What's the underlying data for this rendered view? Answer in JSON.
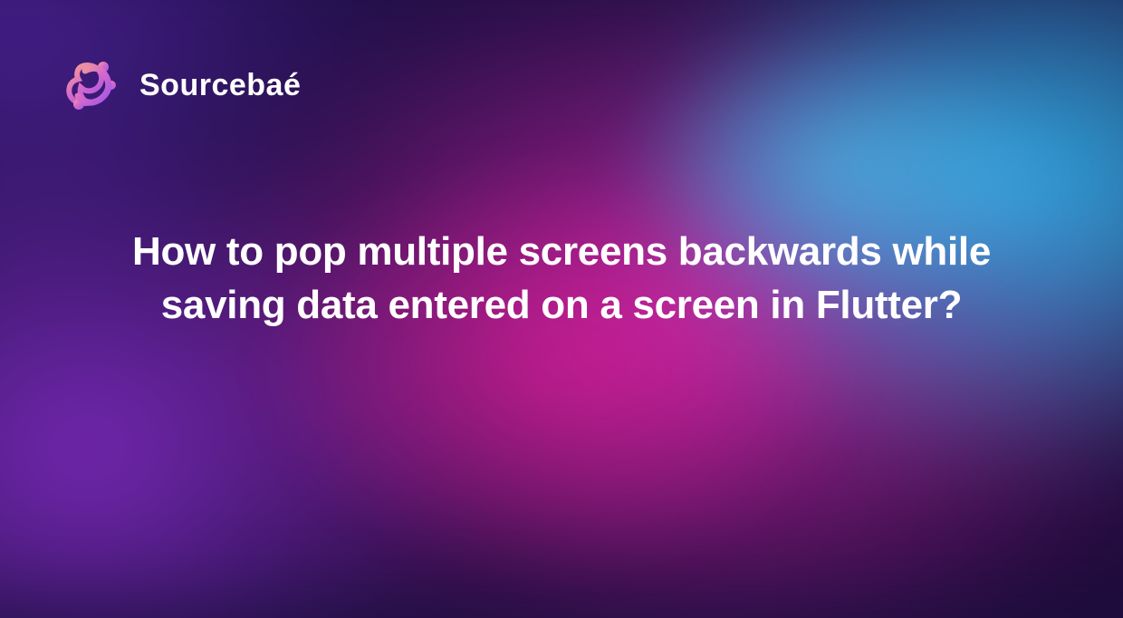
{
  "brand": {
    "name": "Sourcebaé",
    "logo_icon": "sourcebae-logo"
  },
  "headline": "How to pop multiple screens backwards while saving data entered on a screen in Flutter?",
  "colors": {
    "background_base": "#1a0f3d",
    "accent_pink": "#e628b4",
    "accent_cyan": "#2dc8ff",
    "accent_purple": "#9632dc",
    "text": "#ffffff",
    "logo_gradient_start": "#f5a091",
    "logo_gradient_end": "#a155e8"
  }
}
